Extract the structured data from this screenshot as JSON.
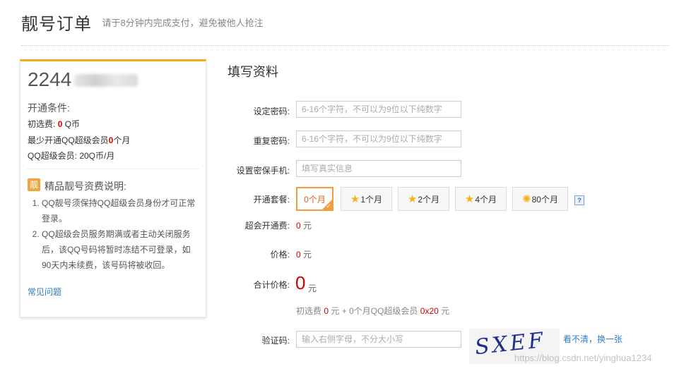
{
  "header": {
    "title": "靓号订单",
    "subtitle": "请于8分钟内完成支付，避免被他人抢注"
  },
  "card": {
    "number": "2244",
    "conditions_title": "开通条件:",
    "initial_fee_label": "初选费:",
    "initial_fee_value": "0",
    "initial_fee_unit": "Q币",
    "min_months_prefix": "最少开通QQ超级会员",
    "min_months_value": "0",
    "min_months_suffix": "个月",
    "svip_price": "QQ超级会员: 20Q币/月",
    "badge": "靓",
    "fee_title": "精品靓号资费说明:",
    "notes": [
      "QQ靓号须保持QQ超级会员身份才可正常登录。",
      "QQ超级会员服务期满或者主动关闭服务后，该QQ号码将暂时冻结不可登录，如90天内未续费，该号码将被收回。"
    ],
    "faq_link": "常见问题"
  },
  "form": {
    "title": "填写资料",
    "password_label": "设定密码:",
    "password_placeholder": "6-16个字符，不可以为9位以下纯数字",
    "repeat_label": "重复密码:",
    "repeat_placeholder": "6-16个字符，不可以为9位以下纯数字",
    "phone_label": "设置密保手机:",
    "phone_placeholder": "填写真实信息",
    "package_label": "开通套餐:",
    "packages": [
      "0个月",
      "1个月",
      "2个月",
      "4个月",
      "80个月"
    ],
    "selected_package": "0个月",
    "help_icon": "?",
    "svip_fee_label": "超会开通费:",
    "svip_fee_value": "0",
    "unit_yuan": "元",
    "price_label": "价格:",
    "price_value": "0",
    "total_label": "合计价格:",
    "total_value": "0",
    "breakdown_prefix": "初选费",
    "breakdown_fee": "0",
    "breakdown_mid": "元 + 0个月QQ超级会员",
    "breakdown_price": "0x20",
    "breakdown_suffix": "元",
    "captcha_label": "验证码:",
    "captcha_placeholder": "输入右侧字母，不分大小写",
    "captcha_text": "SXEF",
    "refresh_link": "看不清，换一张",
    "watermark": "https://blog.csdn.net/yinghua1234"
  },
  "colors": {
    "accent": "#f9a825",
    "price_red": "#d40000",
    "link_blue": "#2d7dc7"
  }
}
